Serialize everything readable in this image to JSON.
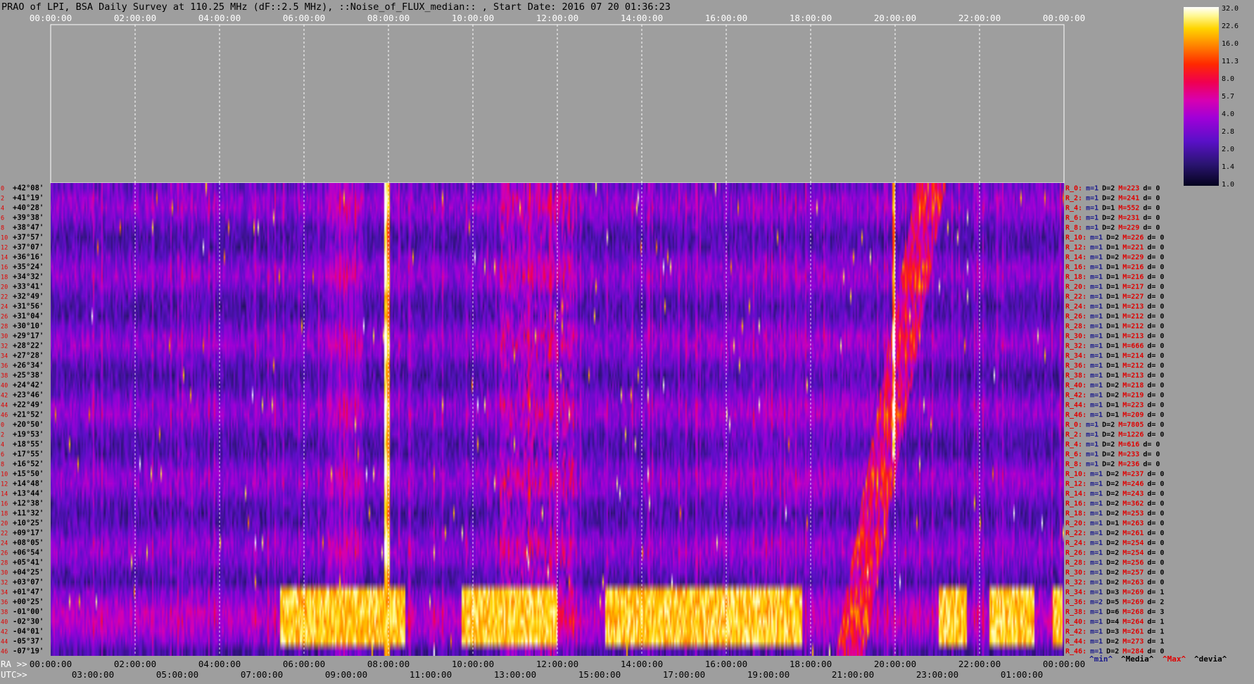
{
  "title": "PRAO of LPI, BSA Daily Survey at 110.25 MHz (dF::2.5 MHz), ::Noise_of_FLUX_median:: , Start Date: 2016 07 20 01:36:23",
  "chart_data": {
    "type": "heatmap",
    "utc_top_labels": [
      "00:00:00",
      "02:00:00",
      "04:00:00",
      "06:00:00",
      "08:00:00",
      "10:00:00",
      "12:00:00",
      "14:00:00",
      "16:00:00",
      "18:00:00",
      "20:00:00",
      "22:00:00",
      "00:00:00"
    ],
    "ra_axis_prefix": "RA >>",
    "ra_bottom_labels": [
      "00:00:00",
      "02:00:00",
      "04:00:00",
      "06:00:00",
      "08:00:00",
      "10:00:00",
      "12:00:00",
      "14:00:00",
      "16:00:00",
      "18:00:00",
      "20:00:00",
      "22:00:00",
      "00:00:00"
    ],
    "utc_axis_prefix": "UTC>>",
    "utc_bottom_labels": [
      "03:00:00",
      "05:00:00",
      "07:00:00",
      "09:00:00",
      "11:00:00",
      "13:00:00",
      "15:00:00",
      "17:00:00",
      "19:00:00",
      "21:00:00",
      "23:00:00",
      "01:00:00"
    ],
    "dec_labels": [
      "+42°08'",
      "+41°19'",
      "+40°28'",
      "+39°38'",
      "+38°47'",
      "+37°57'",
      "+37°07'",
      "+36°16'",
      "+35°24'",
      "+34°32'",
      "+33°41'",
      "+32°49'",
      "+31°56'",
      "+31°04'",
      "+30°10'",
      "+29°17'",
      "+28°22'",
      "+27°28'",
      "+26°34'",
      "+25°38'",
      "+24°42'",
      "+23°46'",
      "+22°49'",
      "+21°52'",
      "+20°50'",
      "+19°53'",
      "+18°55'",
      "+17°55'",
      "+16°52'",
      "+15°50'",
      "+14°48'",
      "+13°44'",
      "+12°38'",
      "+11°32'",
      "+10°25'",
      "+09°17'",
      "+08°05'",
      "+06°54'",
      "+05°41'",
      "+04°25'",
      "+03°07'",
      "+01°47'",
      "+00°25'",
      "-01°00'",
      "-02°30'",
      "-04°01'",
      "-05°37'",
      "-07°19'"
    ],
    "row_index_labels": [
      "0",
      "2",
      "4",
      "6",
      "8",
      "10",
      "12",
      "14",
      "16",
      "18",
      "20",
      "22",
      "24",
      "26",
      "28",
      "30",
      "32",
      "34",
      "36",
      "38",
      "40",
      "42",
      "44",
      "46",
      "0",
      "2",
      "4",
      "6",
      "8",
      "10",
      "12",
      "14",
      "16",
      "18",
      "20",
      "22",
      "24",
      "26",
      "28",
      "30",
      "32",
      "34",
      "36",
      "38",
      "40",
      "42",
      "44",
      "46"
    ],
    "stats_rows": [
      {
        "r": "R_0:",
        "m": "m=1",
        "D": "D=2",
        "M": "M=223",
        "d": "d= 0"
      },
      {
        "r": "R_2:",
        "m": "m=1",
        "D": "D=2",
        "M": "M=241",
        "d": "d= 0"
      },
      {
        "r": "R_4:",
        "m": "m=1",
        "D": "D=1",
        "M": "M=552",
        "d": "d= 0"
      },
      {
        "r": "R_6:",
        "m": "m=1",
        "D": "D=2",
        "M": "M=231",
        "d": "d= 0"
      },
      {
        "r": "R_8:",
        "m": "m=1",
        "D": "D=2",
        "M": "M=229",
        "d": "d= 0"
      },
      {
        "r": "R_10:",
        "m": "m=1",
        "D": "D=2",
        "M": "M=226",
        "d": "d= 0"
      },
      {
        "r": "R_12:",
        "m": "m=1",
        "D": "D=1",
        "M": "M=221",
        "d": "d= 0"
      },
      {
        "r": "R_14:",
        "m": "m=1",
        "D": "D=2",
        "M": "M=229",
        "d": "d= 0"
      },
      {
        "r": "R_16:",
        "m": "m=1",
        "D": "D=1",
        "M": "M=216",
        "d": "d= 0"
      },
      {
        "r": "R_18:",
        "m": "m=1",
        "D": "D=1",
        "M": "M=216",
        "d": "d= 0"
      },
      {
        "r": "R_20:",
        "m": "m=1",
        "D": "D=1",
        "M": "M=217",
        "d": "d= 0"
      },
      {
        "r": "R_22:",
        "m": "m=1",
        "D": "D=1",
        "M": "M=227",
        "d": "d= 0"
      },
      {
        "r": "R_24:",
        "m": "m=1",
        "D": "D=1",
        "M": "M=213",
        "d": "d= 0"
      },
      {
        "r": "R_26:",
        "m": "m=1",
        "D": "D=1",
        "M": "M=212",
        "d": "d= 0"
      },
      {
        "r": "R_28:",
        "m": "m=1",
        "D": "D=1",
        "M": "M=212",
        "d": "d= 0"
      },
      {
        "r": "R_30:",
        "m": "m=1",
        "D": "D=1",
        "M": "M=213",
        "d": "d= 0"
      },
      {
        "r": "R_32:",
        "m": "m=1",
        "D": "D=1",
        "M": "M=666",
        "d": "d= 0"
      },
      {
        "r": "R_34:",
        "m": "m=1",
        "D": "D=1",
        "M": "M=214",
        "d": "d= 0"
      },
      {
        "r": "R_36:",
        "m": "m=1",
        "D": "D=1",
        "M": "M=212",
        "d": "d= 0"
      },
      {
        "r": "R_38:",
        "m": "m=1",
        "D": "D=1",
        "M": "M=213",
        "d": "d= 0"
      },
      {
        "r": "R_40:",
        "m": "m=1",
        "D": "D=2",
        "M": "M=218",
        "d": "d= 0"
      },
      {
        "r": "R_42:",
        "m": "m=1",
        "D": "D=2",
        "M": "M=219",
        "d": "d= 0"
      },
      {
        "r": "R_44:",
        "m": "m=1",
        "D": "D=1",
        "M": "M=223",
        "d": "d= 0"
      },
      {
        "r": "R_46:",
        "m": "m=1",
        "D": "D=1",
        "M": "M=209",
        "d": "d= 0"
      },
      {
        "r": "R_0:",
        "m": "m=1",
        "D": "D=2",
        "M": "M=7805",
        "d": "d= 0"
      },
      {
        "r": "R_2:",
        "m": "m=1",
        "D": "D=2",
        "M": "M=1226",
        "d": "d= 0"
      },
      {
        "r": "R_4:",
        "m": "m=1",
        "D": "D=2",
        "M": "M=616",
        "d": "d= 0"
      },
      {
        "r": "R_6:",
        "m": "m=1",
        "D": "D=2",
        "M": "M=233",
        "d": "d= 0"
      },
      {
        "r": "R_8:",
        "m": "m=1",
        "D": "D=2",
        "M": "M=236",
        "d": "d= 0"
      },
      {
        "r": "R_10:",
        "m": "m=1",
        "D": "D=2",
        "M": "M=237",
        "d": "d= 0"
      },
      {
        "r": "R_12:",
        "m": "m=1",
        "D": "D=2",
        "M": "M=246",
        "d": "d= 0"
      },
      {
        "r": "R_14:",
        "m": "m=1",
        "D": "D=2",
        "M": "M=243",
        "d": "d= 0"
      },
      {
        "r": "R_16:",
        "m": "m=1",
        "D": "D=2",
        "M": "M=362",
        "d": "d= 0"
      },
      {
        "r": "R_18:",
        "m": "m=1",
        "D": "D=2",
        "M": "M=253",
        "d": "d= 0"
      },
      {
        "r": "R_20:",
        "m": "m=1",
        "D": "D=1",
        "M": "M=263",
        "d": "d= 0"
      },
      {
        "r": "R_22:",
        "m": "m=1",
        "D": "D=2",
        "M": "M=261",
        "d": "d= 0"
      },
      {
        "r": "R_24:",
        "m": "m=1",
        "D": "D=2",
        "M": "M=254",
        "d": "d= 0"
      },
      {
        "r": "R_26:",
        "m": "m=1",
        "D": "D=2",
        "M": "M=254",
        "d": "d= 0"
      },
      {
        "r": "R_28:",
        "m": "m=1",
        "D": "D=2",
        "M": "M=256",
        "d": "d= 0"
      },
      {
        "r": "R_30:",
        "m": "m=1",
        "D": "D=2",
        "M": "M=257",
        "d": "d= 0"
      },
      {
        "r": "R_32:",
        "m": "m=1",
        "D": "D=2",
        "M": "M=263",
        "d": "d= 0"
      },
      {
        "r": "R_34:",
        "m": "m=1",
        "D": "D=3",
        "M": "M=269",
        "d": "d= 1"
      },
      {
        "r": "R_36:",
        "m": "m=2",
        "D": "D=5",
        "M": "M=269",
        "d": "d= 2"
      },
      {
        "r": "R_38:",
        "m": "m=1",
        "D": "D=6",
        "M": "M=268",
        "d": "d= 3"
      },
      {
        "r": "R_40:",
        "m": "m=1",
        "D": "D=4",
        "M": "M=264",
        "d": "d= 1"
      },
      {
        "r": "R_42:",
        "m": "m=1",
        "D": "D=3",
        "M": "M=261",
        "d": "d= 1"
      },
      {
        "r": "R_44:",
        "m": "m=1",
        "D": "D=2",
        "M": "M=273",
        "d": "d= 1"
      },
      {
        "r": "R_46:",
        "m": "m=1",
        "D": "D=2",
        "M": "M=284",
        "d": "d= 0"
      }
    ],
    "stats_legend": [
      {
        "label": "^min^",
        "color": "#1a1a8c"
      },
      {
        "label": "^Media^",
        "color": "#000000"
      },
      {
        "label": "^Max^",
        "color": "#e00000"
      },
      {
        "label": "^devia^",
        "color": "#000000"
      }
    ],
    "colorbar": {
      "ticks": [
        "32.0",
        "22.6",
        "16.0",
        "11.3",
        "8.0",
        "5.7",
        "4.0",
        "2.8",
        "2.0",
        "1.4",
        "1.0"
      ],
      "range": [
        1.0,
        32.0
      ],
      "scale": "log2"
    },
    "colors": {
      "background": "#9e9e9e",
      "stat_label": "#e00000",
      "stat_min": "#1a1a8c",
      "stat_media": "#000000",
      "stat_max": "#e00000"
    }
  }
}
